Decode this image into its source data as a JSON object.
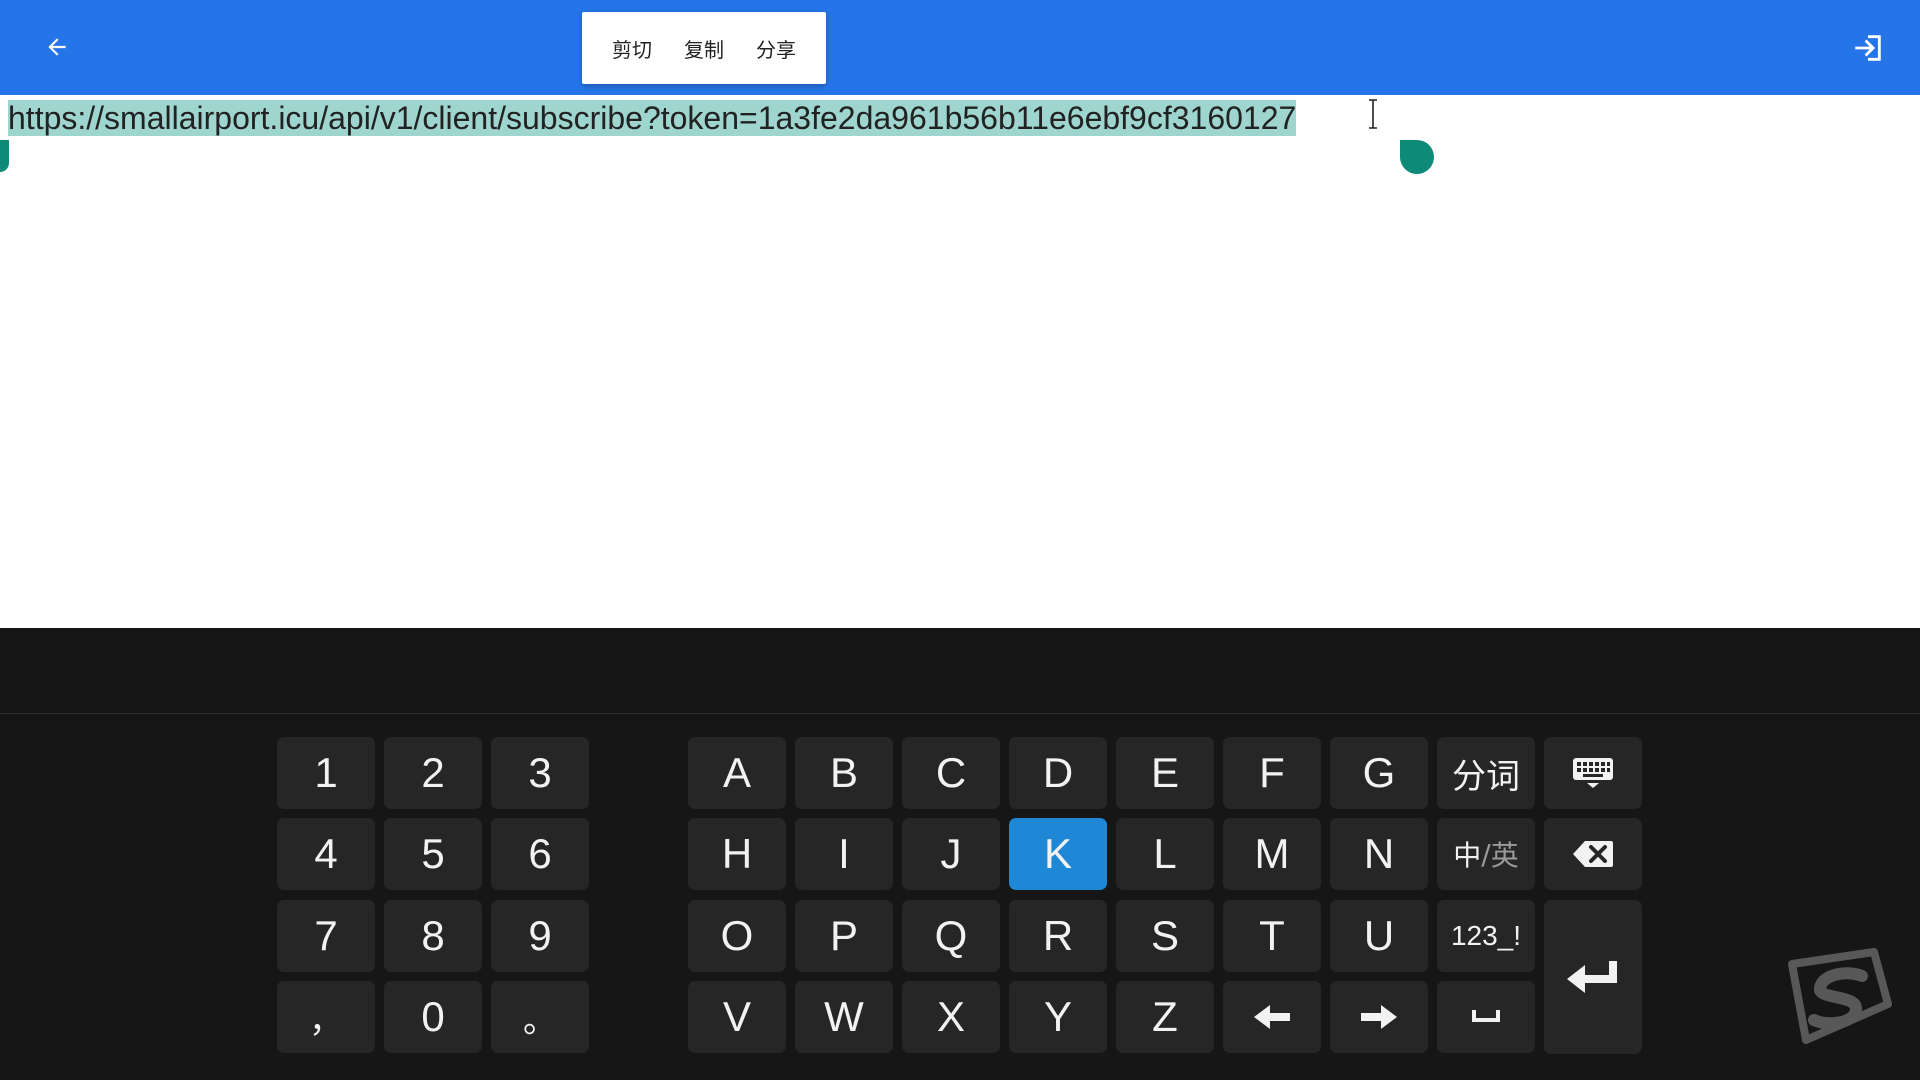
{
  "toolbar": {
    "back_icon": "arrow-left-icon",
    "exit_icon": "sign-in-icon"
  },
  "context_menu": {
    "cut": "剪切",
    "copy": "复制",
    "share": "分享"
  },
  "editor": {
    "text": "https://smallairport.icu/api/v1/client/subscribe?token=1a3fe2da961b56b11e6ebf9cf3160127",
    "selection_color": "#9fd5cf",
    "handle_color": "#0d8a78"
  },
  "keyboard": {
    "numpad": [
      "1",
      "2",
      "3",
      "4",
      "5",
      "6",
      "7",
      "8",
      "9",
      "，",
      "0",
      "。"
    ],
    "letters_row1": [
      "A",
      "B",
      "C",
      "D",
      "E",
      "F",
      "G"
    ],
    "letters_row2": [
      "H",
      "I",
      "J",
      "K",
      "L",
      "M",
      "N"
    ],
    "letters_row3": [
      "O",
      "P",
      "Q",
      "R",
      "S",
      "T",
      "U"
    ],
    "letters_row4": [
      "V",
      "W",
      "X",
      "Y",
      "Z"
    ],
    "segment_label": "分词",
    "lang_toggle": {
      "zh": "中",
      "sep": "/",
      "en": "英"
    },
    "symbols_label": "123_!",
    "active_key": "K",
    "active_color": "#1f88d6",
    "icons": {
      "hide": "keyboard-icon",
      "backspace": "backspace-icon",
      "enter": "enter-icon",
      "left": "arrow-left-icon",
      "right": "arrow-right-icon",
      "space": "space-icon"
    }
  },
  "watermark_icon": "s-logo-icon"
}
